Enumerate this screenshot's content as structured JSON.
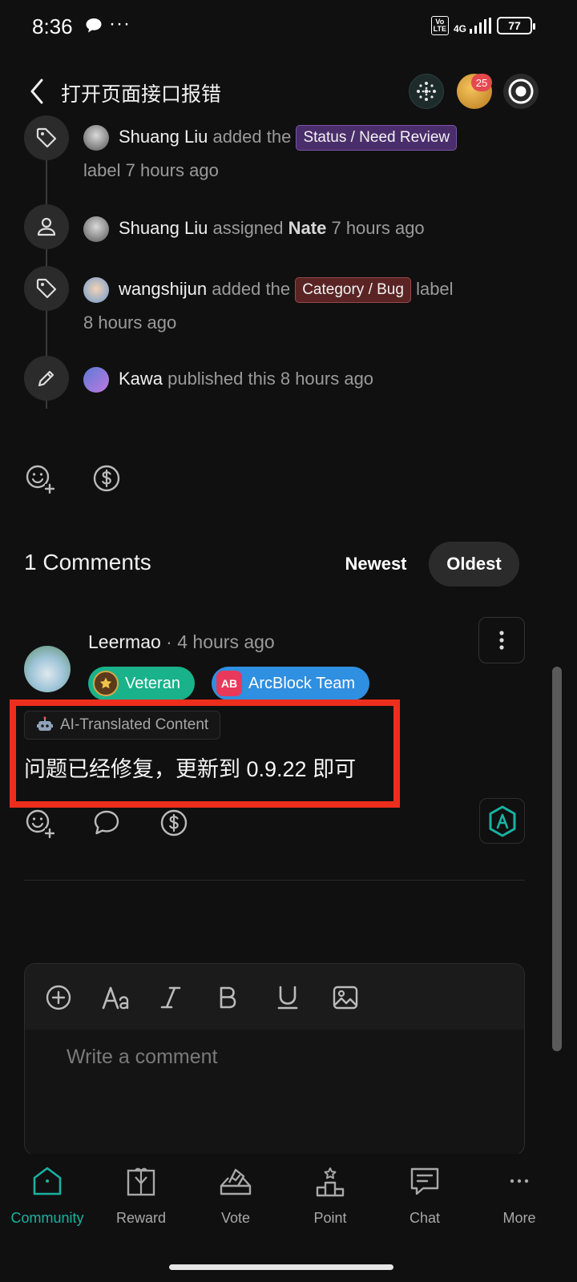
{
  "status_bar": {
    "time": "8:36",
    "dots": "···",
    "volte": "Vo\nLTE",
    "network": "4G",
    "battery": "77"
  },
  "header": {
    "title": "打开页面接口报错",
    "notification_count": "25"
  },
  "timeline": [
    {
      "icon": "tag-icon",
      "user": "Shuang Liu",
      "action": "added the",
      "label": "Status / Need Review",
      "suffix": "label",
      "time": "7 hours ago"
    },
    {
      "icon": "user-icon",
      "user": "Shuang Liu",
      "action": "assigned",
      "assignee": "Nate",
      "time": "7 hours ago"
    },
    {
      "icon": "tag-icon",
      "user": "wangshijun",
      "action": "added the",
      "label": "Category / Bug",
      "suffix": "label",
      "time": "8 hours ago"
    },
    {
      "icon": "pencil-icon",
      "user": "Kawa",
      "action": "published this",
      "time": "8 hours ago"
    }
  ],
  "comments": {
    "title": "1 Comments",
    "sort_newest": "Newest",
    "sort_oldest": "Oldest",
    "selected_sort": "Oldest",
    "items": [
      {
        "author": "Leermao",
        "separator": "·",
        "time": "4 hours ago",
        "badges": [
          "Veteran",
          "ArcBlock Team"
        ],
        "arc_badge_icon": "AB",
        "ai_chip": "AI-Translated Content",
        "body": "问题已经修复，更新到 0.9.22 即可"
      }
    ]
  },
  "editor": {
    "placeholder": "Write a comment"
  },
  "bottom_nav": [
    {
      "label": "Community",
      "icon": "home-icon",
      "active": true
    },
    {
      "label": "Reward",
      "icon": "gift-icon",
      "active": false
    },
    {
      "label": "Vote",
      "icon": "ballot-icon",
      "active": false
    },
    {
      "label": "Point",
      "icon": "podium-icon",
      "active": false
    },
    {
      "label": "Chat",
      "icon": "chat-icon",
      "active": false
    },
    {
      "label": "More",
      "icon": "more-icon",
      "active": false
    }
  ],
  "colors": {
    "background": "#101010",
    "accent": "#18b2a2",
    "highlight": "#ee2e1c",
    "veteran": "#19b28a",
    "arcblock": "#2f8fe0",
    "chip_purple": "#4a2d6b",
    "chip_red": "#5a2424"
  }
}
